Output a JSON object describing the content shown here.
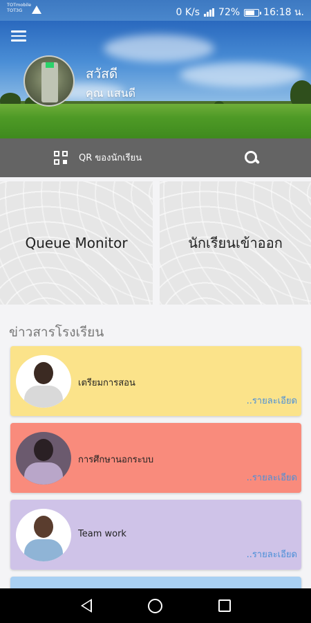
{
  "status_bar": {
    "carrier_line1": "TOTmobile",
    "carrier_line2": "TOT3G",
    "net_speed": "0 K/s",
    "battery": "72%",
    "time": "16:18 น.",
    "icons": [
      "warning-icon",
      "signal-icon",
      "battery-icon"
    ]
  },
  "header": {
    "greeting": "สวัสดี",
    "user_name": "คุณ แสนดี",
    "menu_icon": "hamburger-menu-icon"
  },
  "qr_bar": {
    "qr_label": "QR ของนักเรียน",
    "qr_icon": "qr-code-icon",
    "search_icon": "search-icon"
  },
  "tiles": [
    {
      "label": "Queue Monitor"
    },
    {
      "label": "นักเรียนเข้าออก"
    }
  ],
  "news": {
    "section_title": "ข่าวสารโรงเรียน",
    "items": [
      {
        "title": "เตรียมการสอน",
        "more": "..รายละเอียด",
        "color": "#fbe38a"
      },
      {
        "title": "การศึกษานอกระบบ",
        "more": "..รายละเอียด",
        "color": "#f98b7c"
      },
      {
        "title": "Team work",
        "more": "..รายละเอียด",
        "color": "#cfc3e8"
      }
    ]
  },
  "nav": {
    "back_icon": "back-triangle-icon",
    "home_icon": "home-circle-icon",
    "recent_icon": "recent-apps-square-icon"
  }
}
